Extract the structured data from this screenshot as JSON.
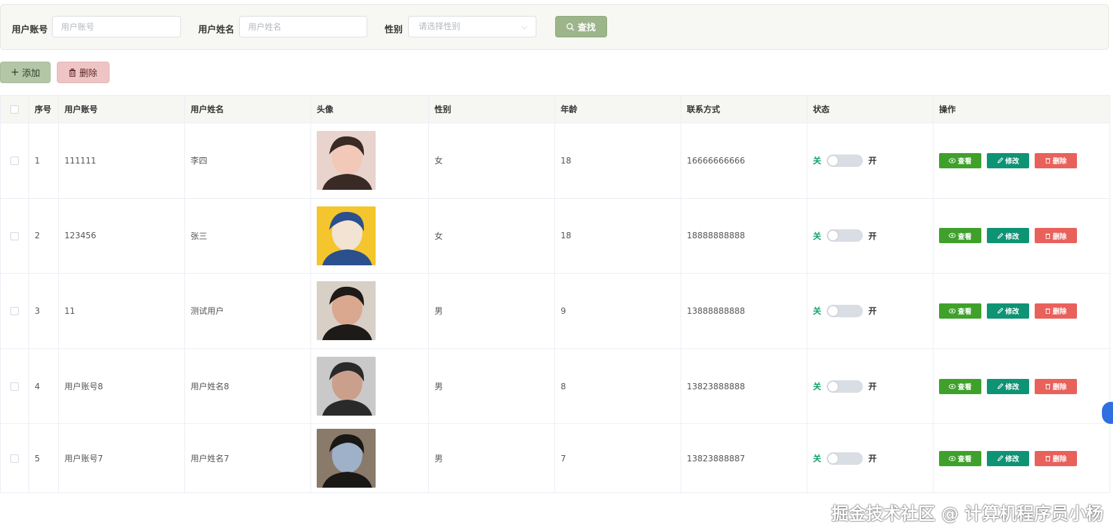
{
  "search": {
    "account_label": "用户账号",
    "account_placeholder": "用户账号",
    "name_label": "用户姓名",
    "name_placeholder": "用户姓名",
    "gender_label": "性别",
    "gender_placeholder": "请选择性别",
    "search_button": "查找"
  },
  "toolbar": {
    "add_label": "添加",
    "delete_label": "删除"
  },
  "table": {
    "headers": {
      "index": "序号",
      "account": "用户账号",
      "name": "用户姓名",
      "avatar": "头像",
      "gender": "性别",
      "age": "年龄",
      "contact": "联系方式",
      "status": "状态",
      "actions": "操作"
    },
    "rows": [
      {
        "index": "1",
        "account": "111111",
        "name": "李四",
        "gender": "女",
        "age": "18",
        "contact": "16666666666",
        "avatar_colors": [
          "#e8d4cc",
          "#3a2a26",
          "#f2c8b8"
        ]
      },
      {
        "index": "2",
        "account": "123456",
        "name": "张三",
        "gender": "女",
        "age": "18",
        "contact": "18888888888",
        "avatar_colors": [
          "#f4c52c",
          "#2c4f8e",
          "#f3e3d2"
        ]
      },
      {
        "index": "3",
        "account": "11",
        "name": "测试用户",
        "gender": "男",
        "age": "9",
        "contact": "13888888888",
        "avatar_colors": [
          "#d8cfc6",
          "#1d1a18",
          "#d9a88f"
        ]
      },
      {
        "index": "4",
        "account": "用户账号8",
        "name": "用户姓名8",
        "gender": "男",
        "age": "8",
        "contact": "13823888888",
        "avatar_colors": [
          "#c9c9c9",
          "#2a2a2a",
          "#caa08c"
        ]
      },
      {
        "index": "5",
        "account": "用户账号7",
        "name": "用户姓名7",
        "gender": "男",
        "age": "7",
        "contact": "13823888887",
        "avatar_colors": [
          "#8a7a6a",
          "#1a1815",
          "#9fb1c9"
        ]
      }
    ],
    "status_off": "关",
    "status_on": "开",
    "action_view": "查看",
    "action_edit": "修改",
    "action_delete": "删除"
  },
  "watermark": "掘金技术社区 @ 计算机程序员小杨",
  "colors": {
    "search_button": "#9db58a",
    "add_button": "#b3c7a6",
    "delete_button": "#efc4c4",
    "view_button": "#3fa12b",
    "edit_button": "#0f9375",
    "row_delete_button": "#e9615b",
    "status_off_text": "#13a26b"
  }
}
